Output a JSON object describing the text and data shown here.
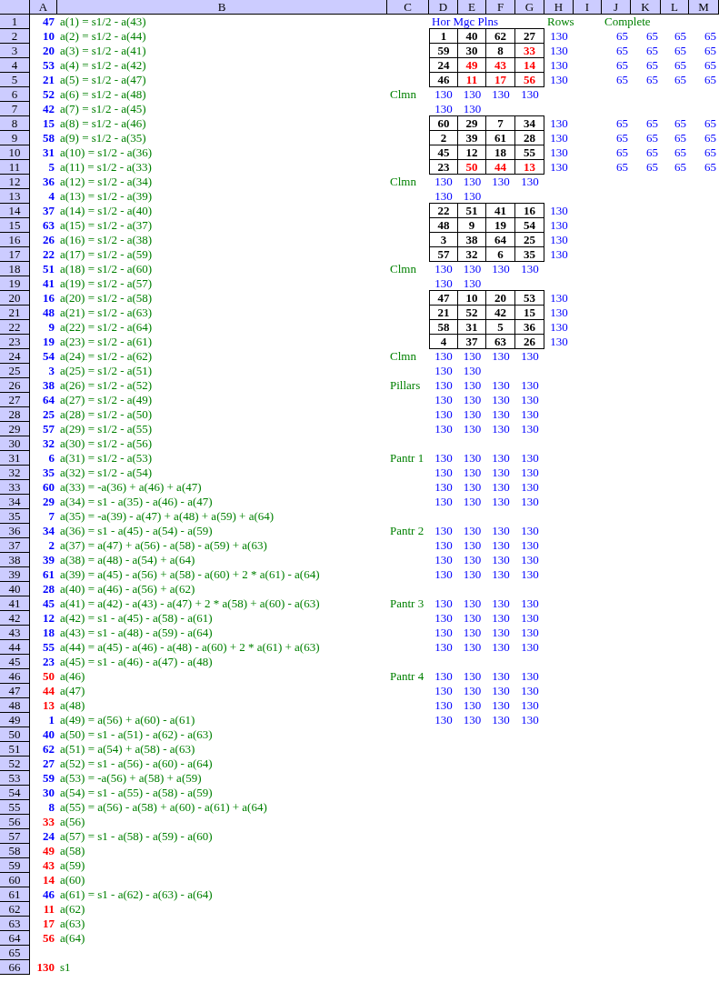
{
  "columns": [
    "A",
    "B",
    "C",
    "D",
    "E",
    "F",
    "G",
    "H",
    "I",
    "J",
    "K",
    "L",
    "M"
  ],
  "rows": [
    {
      "number": "1",
      "value": {
        "text": "47",
        "color": "#0000ff"
      },
      "formula": "a(1) = s1/2 - a(43)",
      "heading": "Hor Mgc Plns",
      "rows_heading": "Rows",
      "complete_heading": "Complete"
    },
    {
      "number": "2",
      "value": {
        "text": "10",
        "color": "#0000ff"
      },
      "formula": "a(2) = s1/2 - a(44)",
      "square": [
        {
          "text": "1",
          "color": "#000000"
        },
        {
          "text": "40",
          "color": "#000000"
        },
        {
          "text": "62",
          "color": "#000000"
        },
        {
          "text": "27",
          "color": "#000000"
        }
      ],
      "row_sum": "130",
      "complete": [
        "65",
        "65",
        "65",
        "65"
      ]
    },
    {
      "number": "3",
      "value": {
        "text": "20",
        "color": "#0000ff"
      },
      "formula": "a(3) = s1/2 - a(41)",
      "square": [
        {
          "text": "59",
          "color": "#000000"
        },
        {
          "text": "30",
          "color": "#000000"
        },
        {
          "text": "8",
          "color": "#000000"
        },
        {
          "text": "33",
          "color": "#ff0000"
        }
      ],
      "row_sum": "130",
      "complete": [
        "65",
        "65",
        "65",
        "65"
      ]
    },
    {
      "number": "4",
      "value": {
        "text": "53",
        "color": "#0000ff"
      },
      "formula": "a(4) = s1/2 - a(42)",
      "square": [
        {
          "text": "24",
          "color": "#000000"
        },
        {
          "text": "49",
          "color": "#ff0000"
        },
        {
          "text": "43",
          "color": "#ff0000"
        },
        {
          "text": "14",
          "color": "#ff0000"
        }
      ],
      "row_sum": "130",
      "complete": [
        "65",
        "65",
        "65",
        "65"
      ]
    },
    {
      "number": "5",
      "value": {
        "text": "21",
        "color": "#0000ff"
      },
      "formula": "a(5) = s1/2 - a(47)",
      "square": [
        {
          "text": "46",
          "color": "#000000"
        },
        {
          "text": "11",
          "color": "#ff0000"
        },
        {
          "text": "17",
          "color": "#ff0000"
        },
        {
          "text": "56",
          "color": "#ff0000"
        }
      ],
      "row_sum": "130",
      "complete": [
        "65",
        "65",
        "65",
        "65"
      ]
    },
    {
      "number": "6",
      "value": {
        "text": "52",
        "color": "#0000ff"
      },
      "formula": "a(6) = s1/2 - a(48)",
      "label": "Clmn",
      "sums": [
        "130",
        "130",
        "130",
        "130"
      ]
    },
    {
      "number": "7",
      "value": {
        "text": "42",
        "color": "#0000ff"
      },
      "formula": "a(7) = s1/2 - a(45)",
      "sums": [
        "130",
        "130"
      ]
    },
    {
      "number": "8",
      "value": {
        "text": "15",
        "color": "#0000ff"
      },
      "formula": "a(8) = s1/2 - a(46)",
      "square": [
        {
          "text": "60",
          "color": "#000000"
        },
        {
          "text": "29",
          "color": "#000000"
        },
        {
          "text": "7",
          "color": "#000000"
        },
        {
          "text": "34",
          "color": "#000000"
        }
      ],
      "row_sum": "130",
      "complete": [
        "65",
        "65",
        "65",
        "65"
      ]
    },
    {
      "number": "9",
      "value": {
        "text": "58",
        "color": "#0000ff"
      },
      "formula": "a(9) = s1/2 - a(35)",
      "square": [
        {
          "text": "2",
          "color": "#000000"
        },
        {
          "text": "39",
          "color": "#000000"
        },
        {
          "text": "61",
          "color": "#000000"
        },
        {
          "text": "28",
          "color": "#000000"
        }
      ],
      "row_sum": "130",
      "complete": [
        "65",
        "65",
        "65",
        "65"
      ]
    },
    {
      "number": "10",
      "value": {
        "text": "31",
        "color": "#0000ff"
      },
      "formula": "a(10) = s1/2 - a(36)",
      "square": [
        {
          "text": "45",
          "color": "#000000"
        },
        {
          "text": "12",
          "color": "#000000"
        },
        {
          "text": "18",
          "color": "#000000"
        },
        {
          "text": "55",
          "color": "#000000"
        }
      ],
      "row_sum": "130",
      "complete": [
        "65",
        "65",
        "65",
        "65"
      ]
    },
    {
      "number": "11",
      "value": {
        "text": "5",
        "color": "#0000ff"
      },
      "formula": "a(11) = s1/2 - a(33)",
      "square": [
        {
          "text": "23",
          "color": "#000000"
        },
        {
          "text": "50",
          "color": "#ff0000"
        },
        {
          "text": "44",
          "color": "#ff0000"
        },
        {
          "text": "13",
          "color": "#ff0000"
        }
      ],
      "row_sum": "130",
      "complete": [
        "65",
        "65",
        "65",
        "65"
      ]
    },
    {
      "number": "12",
      "value": {
        "text": "36",
        "color": "#0000ff"
      },
      "formula": "a(12) = s1/2 - a(34)",
      "label": "Clmn",
      "sums": [
        "130",
        "130",
        "130",
        "130"
      ]
    },
    {
      "number": "13",
      "value": {
        "text": "4",
        "color": "#0000ff"
      },
      "formula": "a(13) = s1/2 - a(39)",
      "sums": [
        "130",
        "130"
      ]
    },
    {
      "number": "14",
      "value": {
        "text": "37",
        "color": "#0000ff"
      },
      "formula": "a(14) = s1/2 - a(40)",
      "square": [
        {
          "text": "22",
          "color": "#000000"
        },
        {
          "text": "51",
          "color": "#000000"
        },
        {
          "text": "41",
          "color": "#000000"
        },
        {
          "text": "16",
          "color": "#000000"
        }
      ],
      "row_sum": "130"
    },
    {
      "number": "15",
      "value": {
        "text": "63",
        "color": "#0000ff"
      },
      "formula": "a(15) = s1/2 - a(37)",
      "square": [
        {
          "text": "48",
          "color": "#000000"
        },
        {
          "text": "9",
          "color": "#000000"
        },
        {
          "text": "19",
          "color": "#000000"
        },
        {
          "text": "54",
          "color": "#000000"
        }
      ],
      "row_sum": "130"
    },
    {
      "number": "16",
      "value": {
        "text": "26",
        "color": "#0000ff"
      },
      "formula": "a(16) = s1/2 - a(38)",
      "square": [
        {
          "text": "3",
          "color": "#000000"
        },
        {
          "text": "38",
          "color": "#000000"
        },
        {
          "text": "64",
          "color": "#000000"
        },
        {
          "text": "25",
          "color": "#000000"
        }
      ],
      "row_sum": "130"
    },
    {
      "number": "17",
      "value": {
        "text": "22",
        "color": "#0000ff"
      },
      "formula": "a(17) = s1/2 - a(59)",
      "square": [
        {
          "text": "57",
          "color": "#000000"
        },
        {
          "text": "32",
          "color": "#000000"
        },
        {
          "text": "6",
          "color": "#000000"
        },
        {
          "text": "35",
          "color": "#000000"
        }
      ],
      "row_sum": "130"
    },
    {
      "number": "18",
      "value": {
        "text": "51",
        "color": "#0000ff"
      },
      "formula": "a(18) = s1/2 - a(60)",
      "label": "Clmn",
      "sums": [
        "130",
        "130",
        "130",
        "130"
      ]
    },
    {
      "number": "19",
      "value": {
        "text": "41",
        "color": "#0000ff"
      },
      "formula": "a(19) = s1/2 - a(57)",
      "sums": [
        "130",
        "130"
      ]
    },
    {
      "number": "20",
      "value": {
        "text": "16",
        "color": "#0000ff"
      },
      "formula": "a(20) = s1/2 - a(58)",
      "square": [
        {
          "text": "47",
          "color": "#000000"
        },
        {
          "text": "10",
          "color": "#000000"
        },
        {
          "text": "20",
          "color": "#000000"
        },
        {
          "text": "53",
          "color": "#000000"
        }
      ],
      "row_sum": "130"
    },
    {
      "number": "21",
      "value": {
        "text": "48",
        "color": "#0000ff"
      },
      "formula": "a(21) = s1/2 - a(63)",
      "square": [
        {
          "text": "21",
          "color": "#000000"
        },
        {
          "text": "52",
          "color": "#000000"
        },
        {
          "text": "42",
          "color": "#000000"
        },
        {
          "text": "15",
          "color": "#000000"
        }
      ],
      "row_sum": "130"
    },
    {
      "number": "22",
      "value": {
        "text": "9",
        "color": "#0000ff"
      },
      "formula": "a(22) = s1/2 - a(64)",
      "square": [
        {
          "text": "58",
          "color": "#000000"
        },
        {
          "text": "31",
          "color": "#000000"
        },
        {
          "text": "5",
          "color": "#000000"
        },
        {
          "text": "36",
          "color": "#000000"
        }
      ],
      "row_sum": "130"
    },
    {
      "number": "23",
      "value": {
        "text": "19",
        "color": "#0000ff"
      },
      "formula": "a(23) = s1/2 - a(61)",
      "square": [
        {
          "text": "4",
          "color": "#000000"
        },
        {
          "text": "37",
          "color": "#000000"
        },
        {
          "text": "63",
          "color": "#000000"
        },
        {
          "text": "26",
          "color": "#000000"
        }
      ],
      "row_sum": "130"
    },
    {
      "number": "24",
      "value": {
        "text": "54",
        "color": "#0000ff"
      },
      "formula": "a(24) = s1/2 - a(62)",
      "label": "Clmn",
      "sums": [
        "130",
        "130",
        "130",
        "130"
      ]
    },
    {
      "number": "25",
      "value": {
        "text": "3",
        "color": "#0000ff"
      },
      "formula": "a(25) = s1/2 - a(51)",
      "sums": [
        "130",
        "130"
      ]
    },
    {
      "number": "26",
      "value": {
        "text": "38",
        "color": "#0000ff"
      },
      "formula": "a(26) = s1/2 - a(52)",
      "label": "Pillars",
      "sums": [
        "130",
        "130",
        "130",
        "130"
      ]
    },
    {
      "number": "27",
      "value": {
        "text": "64",
        "color": "#0000ff"
      },
      "formula": "a(27) = s1/2 - a(49)",
      "sums": [
        "130",
        "130",
        "130",
        "130"
      ]
    },
    {
      "number": "28",
      "value": {
        "text": "25",
        "color": "#0000ff"
      },
      "formula": "a(28) = s1/2 - a(50)",
      "sums": [
        "130",
        "130",
        "130",
        "130"
      ]
    },
    {
      "number": "29",
      "value": {
        "text": "57",
        "color": "#0000ff"
      },
      "formula": "a(29) = s1/2 - a(55)",
      "sums": [
        "130",
        "130",
        "130",
        "130"
      ]
    },
    {
      "number": "30",
      "value": {
        "text": "32",
        "color": "#0000ff"
      },
      "formula": "a(30) = s1/2 - a(56)"
    },
    {
      "number": "31",
      "value": {
        "text": "6",
        "color": "#0000ff"
      },
      "formula": "a(31) = s1/2 - a(53)",
      "label": "Pantr 1",
      "sums": [
        "130",
        "130",
        "130",
        "130"
      ]
    },
    {
      "number": "32",
      "value": {
        "text": "35",
        "color": "#0000ff"
      },
      "formula": "a(32) = s1/2 - a(54)",
      "sums": [
        "130",
        "130",
        "130",
        "130"
      ]
    },
    {
      "number": "33",
      "value": {
        "text": "60",
        "color": "#0000ff"
      },
      "formula": "a(33) = -a(36) + a(46) + a(47)",
      "sums": [
        "130",
        "130",
        "130",
        "130"
      ]
    },
    {
      "number": "34",
      "value": {
        "text": "29",
        "color": "#0000ff"
      },
      "formula": "a(34) = s1 - a(35) - a(46) - a(47)",
      "sums": [
        "130",
        "130",
        "130",
        "130"
      ]
    },
    {
      "number": "35",
      "value": {
        "text": "7",
        "color": "#0000ff"
      },
      "formula": "a(35) = -a(39) - a(47) + a(48) + a(59) + a(64)"
    },
    {
      "number": "36",
      "value": {
        "text": "34",
        "color": "#0000ff"
      },
      "formula": "a(36) = s1 - a(45) - a(54) - a(59)",
      "label": "Pantr 2",
      "sums": [
        "130",
        "130",
        "130",
        "130"
      ]
    },
    {
      "number": "37",
      "value": {
        "text": "2",
        "color": "#0000ff"
      },
      "formula": "a(37) = a(47) + a(56) - a(58) - a(59) + a(63)",
      "sums": [
        "130",
        "130",
        "130",
        "130"
      ]
    },
    {
      "number": "38",
      "value": {
        "text": "39",
        "color": "#0000ff"
      },
      "formula": "a(38) = a(48) - a(54) + a(64)",
      "sums": [
        "130",
        "130",
        "130",
        "130"
      ]
    },
    {
      "number": "39",
      "value": {
        "text": "61",
        "color": "#0000ff"
      },
      "formula": "a(39) = a(45) - a(56) + a(58) - a(60) + 2 * a(61) - a(64)",
      "sums": [
        "130",
        "130",
        "130",
        "130"
      ]
    },
    {
      "number": "40",
      "value": {
        "text": "28",
        "color": "#0000ff"
      },
      "formula": "a(40) = a(46) - a(56) + a(62)"
    },
    {
      "number": "41",
      "value": {
        "text": "45",
        "color": "#0000ff"
      },
      "formula": "a(41) = a(42) - a(43) - a(47) + 2 * a(58) + a(60) - a(63)",
      "label": "Pantr 3",
      "sums": [
        "130",
        "130",
        "130",
        "130"
      ]
    },
    {
      "number": "42",
      "value": {
        "text": "12",
        "color": "#0000ff"
      },
      "formula": "a(42) = s1 - a(45) - a(58) - a(61)",
      "sums": [
        "130",
        "130",
        "130",
        "130"
      ]
    },
    {
      "number": "43",
      "value": {
        "text": "18",
        "color": "#0000ff"
      },
      "formula": "a(43) = s1 - a(48) - a(59) - a(64)",
      "sums": [
        "130",
        "130",
        "130",
        "130"
      ]
    },
    {
      "number": "44",
      "value": {
        "text": "55",
        "color": "#0000ff"
      },
      "formula": "a(44) = a(45) - a(46) - a(48) - a(60) + 2 * a(61) + a(63)",
      "sums": [
        "130",
        "130",
        "130",
        "130"
      ]
    },
    {
      "number": "45",
      "value": {
        "text": "23",
        "color": "#0000ff"
      },
      "formula": "a(45) = s1 - a(46) - a(47) - a(48)"
    },
    {
      "number": "46",
      "value": {
        "text": "50",
        "color": "#ff0000"
      },
      "formula": "a(46)",
      "label": "Pantr 4",
      "sums": [
        "130",
        "130",
        "130",
        "130"
      ]
    },
    {
      "number": "47",
      "value": {
        "text": "44",
        "color": "#ff0000"
      },
      "formula": "a(47)",
      "sums": [
        "130",
        "130",
        "130",
        "130"
      ]
    },
    {
      "number": "48",
      "value": {
        "text": "13",
        "color": "#ff0000"
      },
      "formula": "a(48)",
      "sums": [
        "130",
        "130",
        "130",
        "130"
      ]
    },
    {
      "number": "49",
      "value": {
        "text": "1",
        "color": "#0000ff"
      },
      "formula": "a(49) = a(56) + a(60) - a(61)",
      "sums": [
        "130",
        "130",
        "130",
        "130"
      ]
    },
    {
      "number": "50",
      "value": {
        "text": "40",
        "color": "#0000ff"
      },
      "formula": "a(50) = s1 - a(51) - a(62) - a(63)"
    },
    {
      "number": "51",
      "value": {
        "text": "62",
        "color": "#0000ff"
      },
      "formula": "a(51) = a(54) + a(58) - a(63)"
    },
    {
      "number": "52",
      "value": {
        "text": "27",
        "color": "#0000ff"
      },
      "formula": "a(52) = s1 - a(56) - a(60) - a(64)"
    },
    {
      "number": "53",
      "value": {
        "text": "59",
        "color": "#0000ff"
      },
      "formula": "a(53) = -a(56) + a(58) + a(59)"
    },
    {
      "number": "54",
      "value": {
        "text": "30",
        "color": "#0000ff"
      },
      "formula": "a(54) = s1 - a(55) - a(58) - a(59)"
    },
    {
      "number": "55",
      "value": {
        "text": "8",
        "color": "#0000ff"
      },
      "formula": "a(55) = a(56) - a(58) + a(60) - a(61) + a(64)"
    },
    {
      "number": "56",
      "value": {
        "text": "33",
        "color": "#ff0000"
      },
      "formula": "a(56)"
    },
    {
      "number": "57",
      "value": {
        "text": "24",
        "color": "#0000ff"
      },
      "formula": "a(57) = s1 - a(58) - a(59) - a(60)"
    },
    {
      "number": "58",
      "value": {
        "text": "49",
        "color": "#ff0000"
      },
      "formula": "a(58)"
    },
    {
      "number": "59",
      "value": {
        "text": "43",
        "color": "#ff0000"
      },
      "formula": "a(59)"
    },
    {
      "number": "60",
      "value": {
        "text": "14",
        "color": "#ff0000"
      },
      "formula": "a(60)"
    },
    {
      "number": "61",
      "value": {
        "text": "46",
        "color": "#0000ff"
      },
      "formula": "a(61) = s1 - a(62) - a(63) - a(64)"
    },
    {
      "number": "62",
      "value": {
        "text": "11",
        "color": "#ff0000"
      },
      "formula": "a(62)"
    },
    {
      "number": "63",
      "value": {
        "text": "17",
        "color": "#ff0000"
      },
      "formula": "a(63)"
    },
    {
      "number": "64",
      "value": {
        "text": "56",
        "color": "#ff0000"
      },
      "formula": "a(64)"
    },
    {
      "number": "65"
    },
    {
      "number": "66",
      "value": {
        "text": "130",
        "color": "#ff0000"
      },
      "formula": "s1"
    }
  ]
}
